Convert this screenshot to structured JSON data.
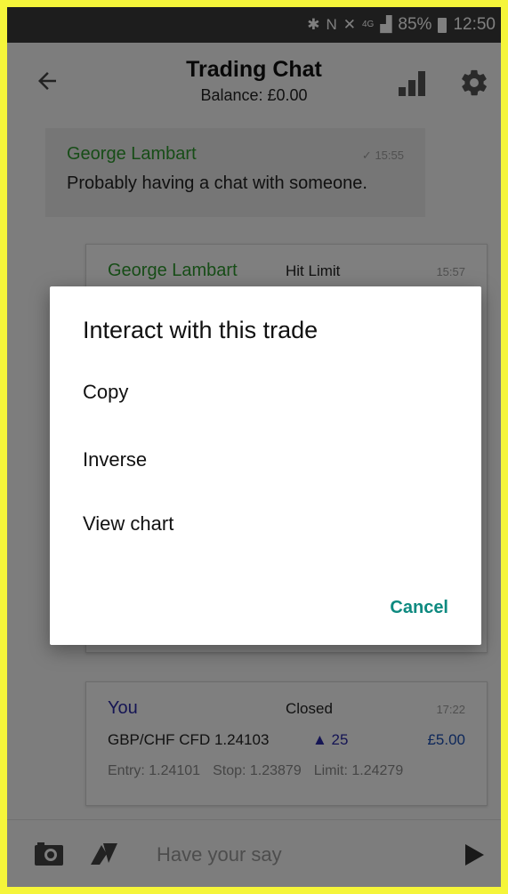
{
  "status_bar": {
    "network": "4G",
    "battery": "85%",
    "time": "12:50"
  },
  "header": {
    "title": "Trading Chat",
    "subtitle": "Balance: £0.00"
  },
  "messages": [
    {
      "sender": "George Lambart",
      "status_tick": "✓",
      "time": "15:55",
      "text": "Probably having a chat with someone."
    }
  ],
  "trades": [
    {
      "sender": "George Lambart",
      "status": "Hit Limit",
      "time": "15:57"
    },
    {
      "sender": "You",
      "status": "Closed",
      "time": "17:22",
      "instrument": "GBP/CHF CFD 1.24103",
      "change": "▲ 25",
      "amount": "£5.00",
      "entry": "Entry: 1.24101",
      "stop": "Stop: 1.23879",
      "limit": "Limit: 1.24279"
    }
  ],
  "input": {
    "placeholder": "Have your say"
  },
  "dialog": {
    "title": "Interact with this trade",
    "options": [
      "Copy",
      "Inverse",
      "View chart"
    ],
    "cancel": "Cancel"
  },
  "colors": {
    "accent_teal": "#0e8a80",
    "sender_green": "#2e9a2e",
    "sender_blue": "#2a2aa8",
    "frame_yellow": "#f5f53a"
  }
}
